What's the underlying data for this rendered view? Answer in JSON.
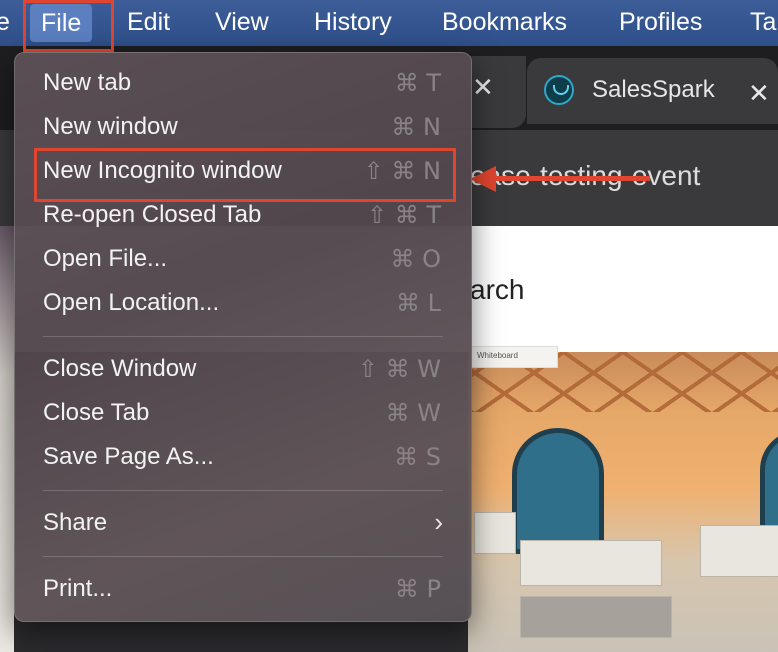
{
  "menubar": {
    "items": [
      "e",
      "File",
      "Edit",
      "View",
      "History",
      "Bookmarks",
      "Profiles",
      "Ta"
    ]
  },
  "tabs": {
    "active_title": "SalesSpark",
    "close_glyph": "✕"
  },
  "urlbar": {
    "text": "ease-testing-event"
  },
  "page": {
    "title_fragment": "arch",
    "whiteboard_tag": "Whiteboard"
  },
  "file_menu": {
    "items": [
      {
        "label": "New tab",
        "shortcut": "⌘ T"
      },
      {
        "label": "New window",
        "shortcut": "⌘ N"
      },
      {
        "label": "New Incognito window",
        "shortcut": "⇧ ⌘ N"
      },
      {
        "label": "Re-open Closed Tab",
        "shortcut": "⇧ ⌘ T"
      },
      {
        "label": "Open File...",
        "shortcut": "⌘ O"
      },
      {
        "label": "Open Location...",
        "shortcut": "⌘ L"
      },
      {
        "label": "Close Window",
        "shortcut": "⇧ ⌘ W"
      },
      {
        "label": "Close Tab",
        "shortcut": "⌘ W"
      },
      {
        "label": "Save Page As...",
        "shortcut": "⌘ S"
      },
      {
        "label": "Share",
        "submenu_glyph": "›"
      },
      {
        "label": "Print...",
        "shortcut": "⌘ P"
      }
    ]
  },
  "colors": {
    "highlight": "#e0452f",
    "menubar": "#355694"
  }
}
